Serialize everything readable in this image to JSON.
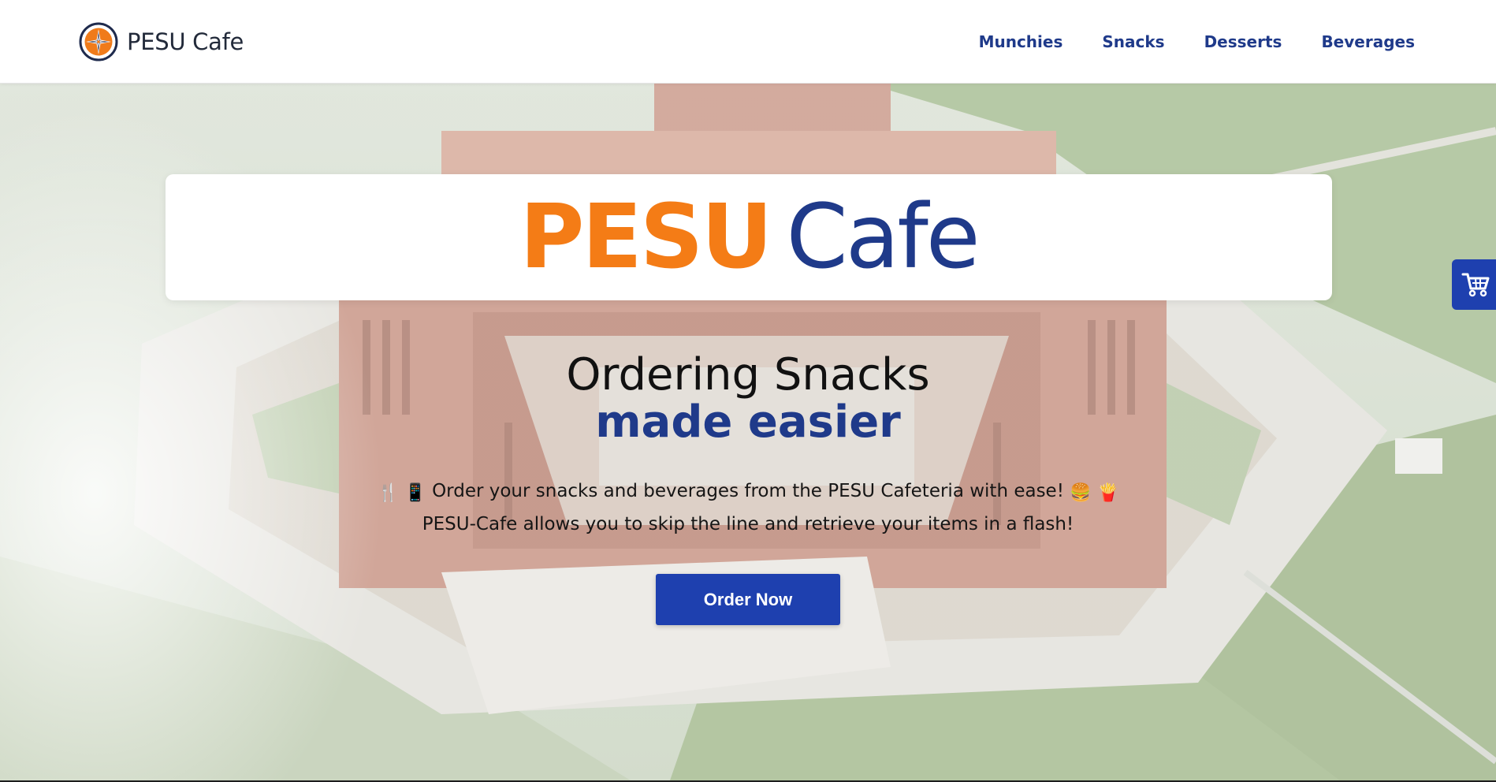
{
  "brand": {
    "name": "PESU Cafe",
    "logo_icon": "compass-icon"
  },
  "nav": {
    "items": [
      {
        "label": "Munchies"
      },
      {
        "label": "Snacks"
      },
      {
        "label": "Desserts"
      },
      {
        "label": "Beverages"
      }
    ]
  },
  "hero": {
    "title_part1": "PESU",
    "title_part2": "Cafe",
    "headline": "Ordering Snacks",
    "subheadline": "made easier",
    "description_line1": {
      "emoji_start_1": "🍴",
      "emoji_start_2": "📱",
      "text": "Order your snacks and beverages from the PESU Cafeteria with ease!",
      "emoji_end_1": "🍔",
      "emoji_end_2": "🍟"
    },
    "description_line2": "PESU-Cafe allows you to skip the line and retrieve your items in a flash!",
    "cta_label": "Order Now",
    "background_icon": "campus-aerial-photo"
  },
  "cart": {
    "icon": "cart-icon"
  },
  "colors": {
    "primary_blue": "#1f3a8a",
    "button_blue": "#1e40af",
    "accent_orange": "#f47c16"
  }
}
